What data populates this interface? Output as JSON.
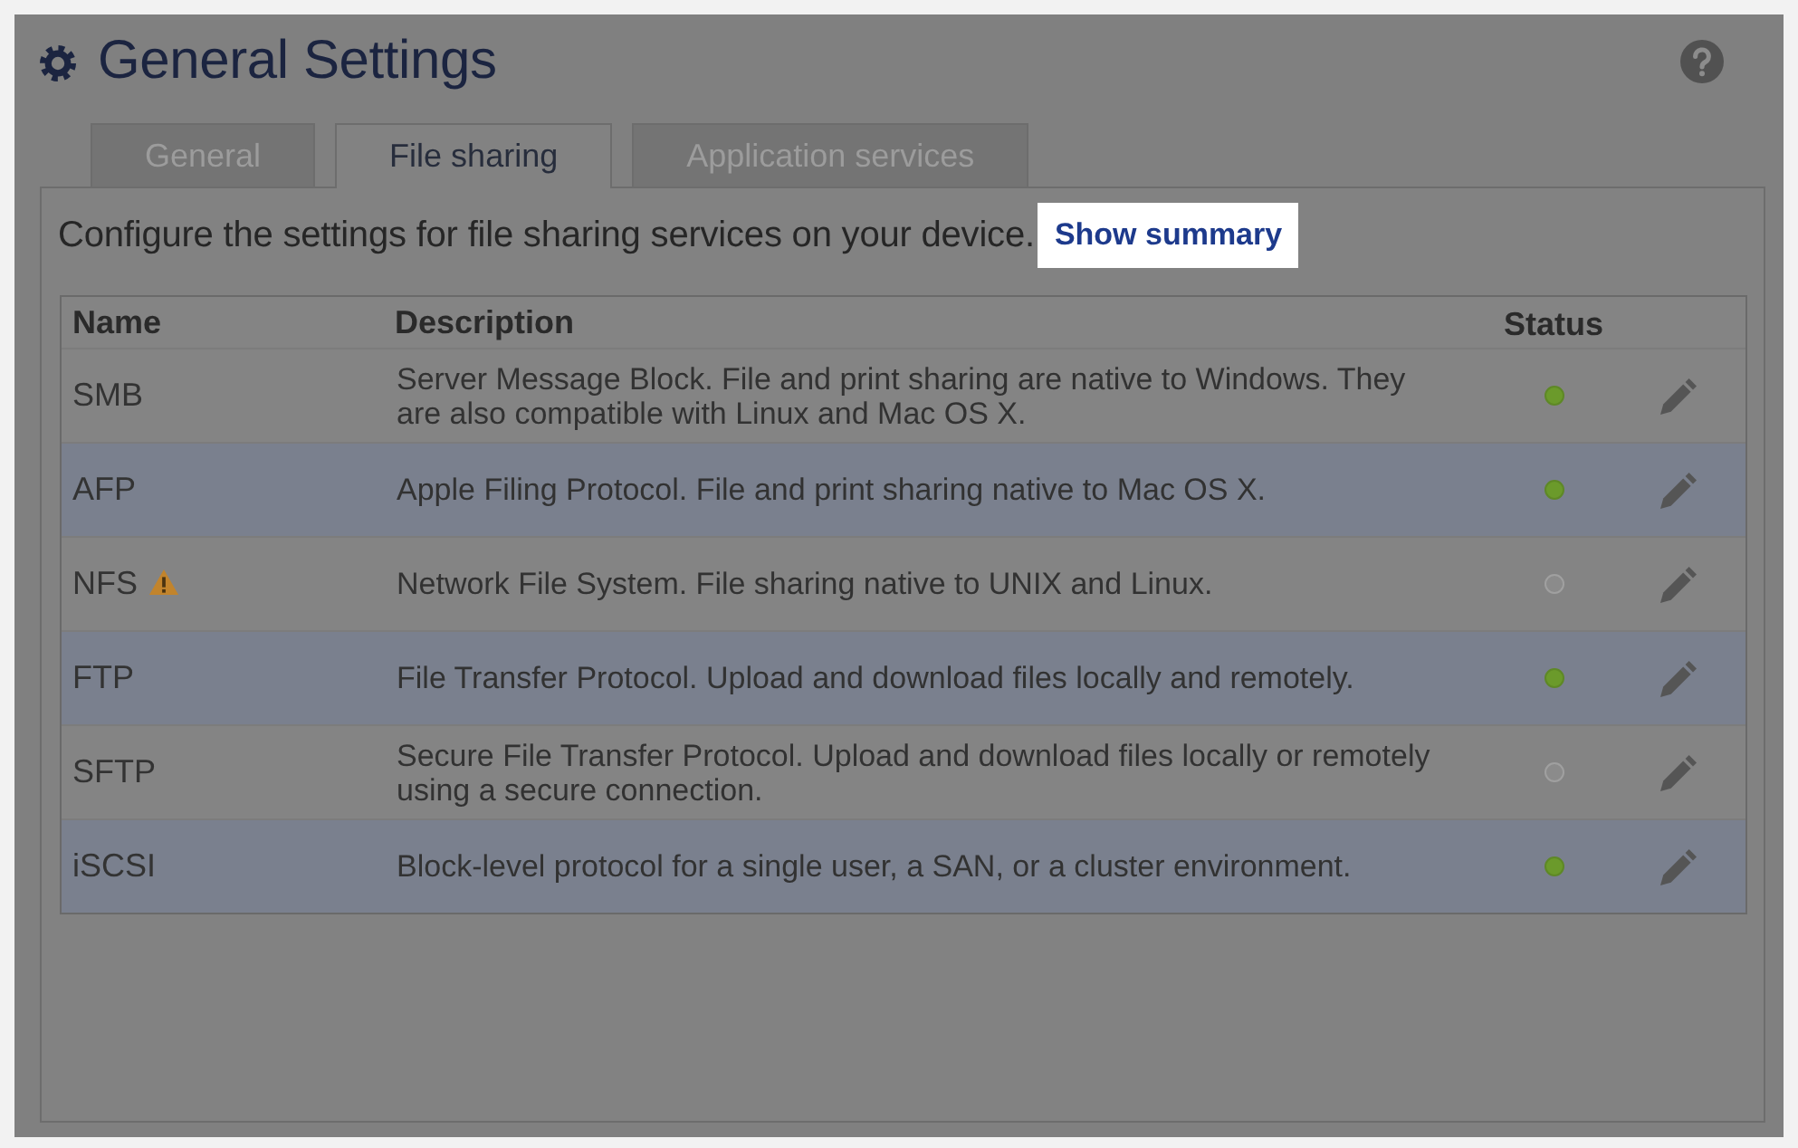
{
  "window": {
    "title": "General Settings"
  },
  "tabs": [
    {
      "label": "General",
      "selected": false
    },
    {
      "label": "File sharing",
      "selected": true
    },
    {
      "label": "Application services",
      "selected": false
    }
  ],
  "intro": {
    "text": "Configure the settings for file sharing services on your device.",
    "link": {
      "label": "Show summary",
      "highlighted": true
    }
  },
  "table": {
    "columns": [
      "Name",
      "Description",
      "Status"
    ],
    "rows": [
      {
        "name": "SMB",
        "warning": false,
        "description": "Server Message Block. File and print sharing are native to Windows. They are also compatible with Linux and Mac OS X.",
        "enabled": true
      },
      {
        "name": "AFP",
        "warning": false,
        "description": "Apple Filing Protocol. File and print sharing native to Mac OS X.",
        "enabled": true
      },
      {
        "name": "NFS",
        "warning": true,
        "description": "Network File System. File sharing native to UNIX and Linux.",
        "enabled": false
      },
      {
        "name": "FTP",
        "warning": false,
        "description": "File Transfer Protocol. Upload and download files locally and remotely.",
        "enabled": true
      },
      {
        "name": "SFTP",
        "warning": false,
        "description": "Secure File Transfer Protocol. Upload and download files locally or remotely using a secure connection.",
        "enabled": false
      },
      {
        "name": "iSCSI",
        "warning": false,
        "description": "Block-level protocol for a single user, a SAN, or a cluster environment.",
        "enabled": true
      }
    ]
  }
}
